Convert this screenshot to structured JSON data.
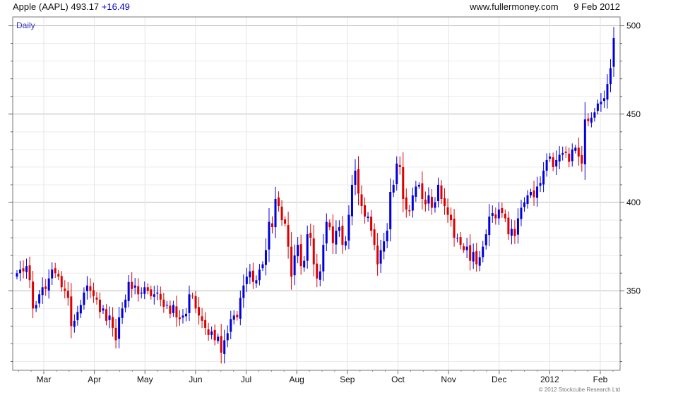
{
  "header": {
    "name": "Apple (AAPL)",
    "price": "493.17",
    "change": "+16.49",
    "site": "www.fullermoney.com",
    "date": "9 Feb 2012"
  },
  "footer": {
    "copyright": "© 2012 Stockcube Research Ltd"
  },
  "colors": {
    "up": "#0000dd",
    "down": "#dd0000",
    "grid": "#d8d8d8",
    "frame": "#777777"
  },
  "chart_data": {
    "type": "candlestick",
    "period_label": "Daily",
    "x_labels": [
      "Mar",
      "Apr",
      "May",
      "Jun",
      "Jul",
      "Aug",
      "Sep",
      "Oct",
      "Nov",
      "Dec",
      "2012",
      "Feb"
    ],
    "y_ticks": [
      350,
      400,
      450,
      500
    ],
    "ylim": [
      305,
      505
    ],
    "grid": true,
    "series": {
      "close": [
        360,
        362,
        361,
        364,
        356,
        340,
        342,
        348,
        352,
        351,
        357,
        362,
        360,
        358,
        352,
        350,
        346,
        330,
        333,
        338,
        342,
        349,
        353,
        350,
        347,
        345,
        338,
        340,
        333,
        336,
        329,
        322,
        335,
        340,
        345,
        355,
        351,
        353,
        348,
        349,
        352,
        350,
        347,
        348,
        349,
        345,
        341,
        342,
        337,
        342,
        335,
        334,
        336,
        337,
        348,
        347,
        340,
        336,
        333,
        329,
        325,
        327,
        322,
        324,
        315,
        322,
        326,
        334,
        336,
        335,
        346,
        353,
        358,
        361,
        355,
        356,
        362,
        365,
        373,
        389,
        386,
        402,
        398,
        390,
        388,
        375,
        358,
        370,
        376,
        364,
        367,
        382,
        380,
        365,
        357,
        361,
        376,
        389,
        386,
        377,
        384,
        386,
        376,
        378,
        393,
        410,
        418,
        405,
        398,
        392,
        392,
        384,
        376,
        365,
        373,
        378,
        384,
        406,
        410,
        422,
        420,
        402,
        396,
        395,
        404,
        409,
        410,
        402,
        399,
        404,
        397,
        400,
        410,
        402,
        398,
        393,
        390,
        380,
        380,
        376,
        373,
        375,
        367,
        372,
        365,
        369,
        375,
        382,
        392,
        394,
        391,
        396,
        394,
        391,
        382,
        385,
        381,
        391,
        397,
        400,
        404,
        406,
        403,
        409,
        411,
        418,
        424,
        426,
        420,
        424,
        427,
        428,
        428,
        423,
        430,
        431,
        426,
        422,
        447,
        446,
        448,
        451,
        456,
        457,
        459,
        467,
        476,
        493
      ],
      "ohlc_note": "open/high/low derived from consecutive closes"
    }
  }
}
